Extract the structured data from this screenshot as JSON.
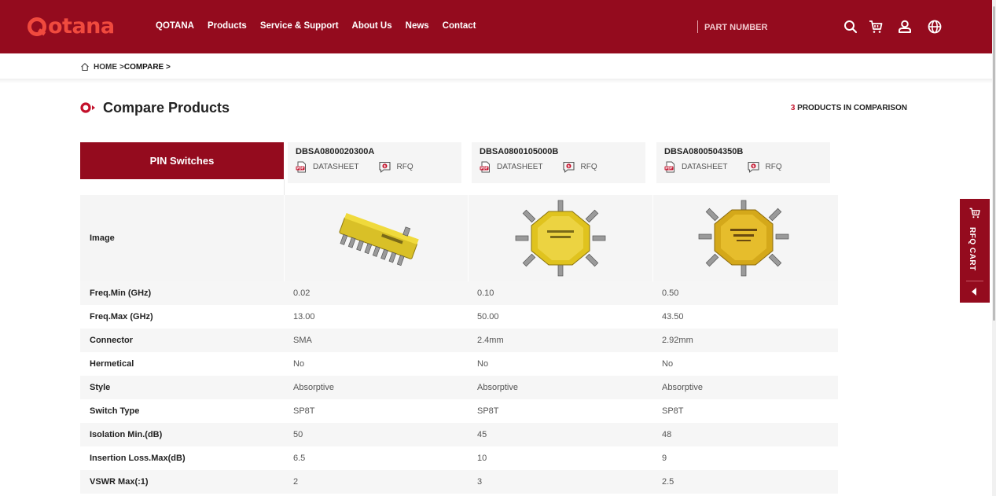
{
  "header": {
    "logo_text": "otana",
    "nav": [
      "QOTANA",
      "Products",
      "Service & Support",
      "About Us",
      "News",
      "Contact"
    ],
    "search_placeholder": "PART NUMBER"
  },
  "breadcrumb": {
    "home": "HOME",
    "sep": ">",
    "current": "COMPARE >"
  },
  "page": {
    "title": "Compare Products",
    "count_number": "3",
    "count_text": " PRODUCTS IN COMPARISON"
  },
  "table": {
    "category": "PIN Switches",
    "datasheet_label": "DATASHEET",
    "rfq_label": "RFQ",
    "products": [
      "DBSA0800020300A",
      "DBSA0800105000B",
      "DBSA0800504350B"
    ],
    "image_row_label": "Image",
    "rows": [
      {
        "label": "Freq.Min (GHz)",
        "values": [
          "0.02",
          "0.10",
          "0.50"
        ]
      },
      {
        "label": "Freq.Max (GHz)",
        "values": [
          "13.00",
          "50.00",
          "43.50"
        ]
      },
      {
        "label": "Connector",
        "values": [
          "SMA",
          "2.4mm",
          "2.92mm"
        ]
      },
      {
        "label": "Hermetical",
        "values": [
          "No",
          "No",
          "No"
        ]
      },
      {
        "label": "Style",
        "values": [
          "Absorptive",
          "Absorptive",
          "Absorptive"
        ]
      },
      {
        "label": "Switch Type",
        "values": [
          "SP8T",
          "SP8T",
          "SP8T"
        ]
      },
      {
        "label": "Isolation Min.(dB)",
        "values": [
          "50",
          "45",
          "48"
        ]
      },
      {
        "label": "Insertion Loss.Max(dB)",
        "values": [
          "6.5",
          "10",
          "9"
        ]
      },
      {
        "label": "VSWR Max(:1)",
        "values": [
          "2",
          "3",
          "2.5"
        ]
      }
    ]
  },
  "side_cart": {
    "label": "RFQ CART"
  },
  "icons": {
    "header": [
      "search-icon",
      "cart-icon",
      "user-icon",
      "globe-icon"
    ],
    "breadcrumb": "home-icon",
    "title": "target-icon",
    "links": [
      "pdf-icon",
      "rfq-icon"
    ],
    "side": [
      "cart-icon",
      "chevron-left-icon"
    ]
  },
  "colors": {
    "brand": "#940b1e",
    "accent": "#c3102a",
    "logo": "#f04a3e"
  }
}
